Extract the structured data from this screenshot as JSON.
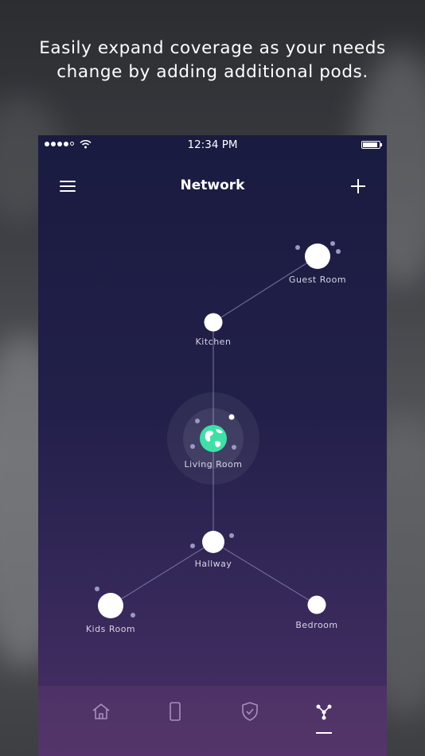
{
  "headline": {
    "line1": "Easily expand coverage as your needs",
    "line2": "change by adding additional pods."
  },
  "status_bar": {
    "time": "12:34 PM"
  },
  "nav": {
    "title": "Network",
    "left_icon": "hamburger-menu-icon",
    "right_icon": "plus-icon"
  },
  "pods": [
    {
      "id": "guest-room",
      "label": "Guest Room"
    },
    {
      "id": "kitchen",
      "label": "Kitchen"
    },
    {
      "id": "living-room",
      "label": "Living Room"
    },
    {
      "id": "hallway",
      "label": "Hallway"
    },
    {
      "id": "kids-room",
      "label": "Kids Room"
    },
    {
      "id": "bedroom",
      "label": "Bedroom"
    }
  ],
  "tabs": [
    {
      "id": "home",
      "icon": "home-icon"
    },
    {
      "id": "devices",
      "icon": "phone-device-icon"
    },
    {
      "id": "security",
      "icon": "shield-check-icon"
    },
    {
      "id": "network",
      "icon": "network-topology-icon",
      "active": true
    }
  ],
  "colors": {
    "accent": "#3ee0a8",
    "background_top": "#1a1b40",
    "background_bottom": "#4a2f66"
  }
}
